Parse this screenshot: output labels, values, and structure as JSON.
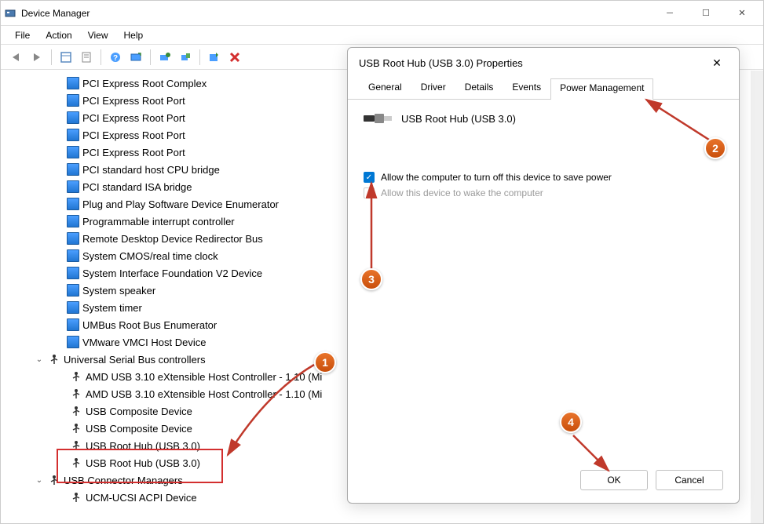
{
  "window": {
    "title": "Device Manager",
    "menu": [
      "File",
      "Action",
      "View",
      "Help"
    ]
  },
  "tree": {
    "system_devices": [
      "PCI Express Root Complex",
      "PCI Express Root Port",
      "PCI Express Root Port",
      "PCI Express Root Port",
      "PCI Express Root Port",
      "PCI standard host CPU bridge",
      "PCI standard ISA bridge",
      "Plug and Play Software Device Enumerator",
      "Programmable interrupt controller",
      "Remote Desktop Device Redirector Bus",
      "System CMOS/real time clock",
      "System Interface Foundation V2 Device",
      "System speaker",
      "System timer",
      "UMBus Root Bus Enumerator",
      "VMware VMCI Host Device"
    ],
    "usb_category": "Universal Serial Bus controllers",
    "usb_devices": [
      "AMD USB 3.10 eXtensible Host Controller - 1.10 (Mi",
      "AMD USB 3.10 eXtensible Host Controller - 1.10 (Mi",
      "USB Composite Device",
      "USB Composite Device",
      "USB Root Hub (USB 3.0)",
      "USB Root Hub (USB 3.0)"
    ],
    "usb_conn_category": "USB Connector Managers",
    "usb_conn_devices": [
      "UCM-UCSI ACPI Device"
    ]
  },
  "dialog": {
    "title": "USB Root Hub (USB 3.0) Properties",
    "tabs": [
      "General",
      "Driver",
      "Details",
      "Events",
      "Power Management"
    ],
    "active_tab": 4,
    "device_name": "USB Root Hub (USB 3.0)",
    "check1_label": "Allow the computer to turn off this device to save power",
    "check2_label": "Allow this device to wake the computer",
    "ok": "OK",
    "cancel": "Cancel"
  },
  "badges": {
    "b1": "1",
    "b2": "2",
    "b3": "3",
    "b4": "4"
  }
}
